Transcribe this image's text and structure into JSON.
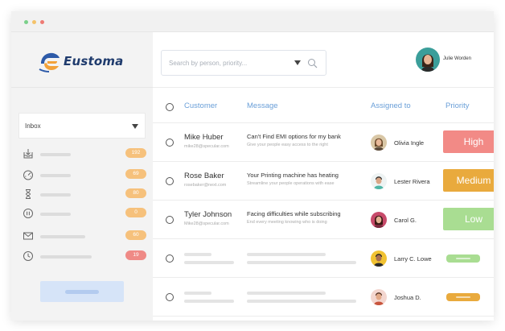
{
  "window": {
    "dots": [
      "#7bd08a",
      "#f4c36a",
      "#ee7b74"
    ]
  },
  "brand": {
    "name": "Eustoma",
    "logo_colors": [
      "#2d5aa8",
      "#f2a23a"
    ]
  },
  "sidebar": {
    "inbox_label": "Inbox",
    "items": [
      {
        "icon": "inbox-download-icon",
        "badge": "192",
        "badge_color": "#f6c17c"
      },
      {
        "icon": "dashboard-gauge-icon",
        "badge": "69",
        "badge_color": "#f6c17c"
      },
      {
        "icon": "hourglass-icon",
        "badge": "80",
        "badge_color": "#f6c17c"
      },
      {
        "icon": "pause-circle-icon",
        "badge": "0",
        "badge_color": "#f6c17c"
      },
      {
        "icon": "mail-icon",
        "badge": "60",
        "badge_color": "#f6c17c"
      },
      {
        "icon": "clock-icon",
        "badge": "19",
        "badge_color": "#ef8a86"
      }
    ]
  },
  "search": {
    "placeholder": "Search by person, priority..."
  },
  "user": {
    "name": "Julie Worden"
  },
  "table": {
    "headers": {
      "customer": "Customer",
      "message": "Message",
      "assigned": "Assigned to",
      "priority": "Priority"
    },
    "rows": [
      {
        "customer": "Mike Huber",
        "email": "mike28@specular.com",
        "message": "Can't Find EMI options for my bank",
        "message_sub": "Give your people easy access to the right",
        "agent": "Olivia Ingle",
        "priority": "High",
        "priority_color": "#f28a86"
      },
      {
        "customer": "Rose Baker",
        "email": "rosebaker@next.com",
        "message": "Your Printing machine has heating",
        "message_sub": "Streamline your people operations with ease",
        "agent": "Lester Rivera",
        "priority": "Medium",
        "priority_color": "#e9aa3d"
      },
      {
        "customer": "Tyler Johnson",
        "email": "Mike28@specular.com",
        "message": "Facing difficulties while subscribing",
        "message_sub": "End every meeting knowing who is doing",
        "agent": "Carol G.",
        "priority": "Low",
        "priority_color": "#a9dd92"
      },
      {
        "agent": "Larry C. Lowe",
        "priority_color": "#a9dd92"
      },
      {
        "agent": "Joshua D.",
        "priority_color": "#e9aa3d"
      }
    ]
  }
}
